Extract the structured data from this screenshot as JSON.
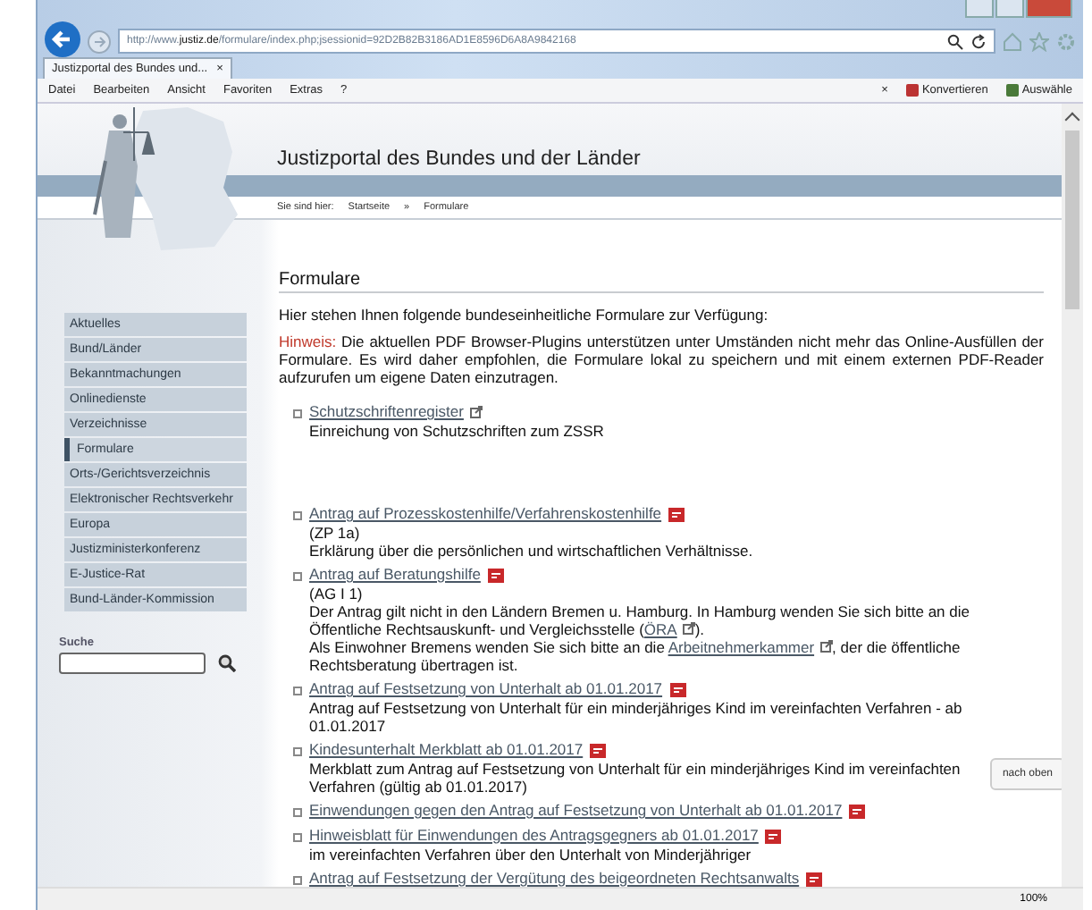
{
  "browser": {
    "address_host": "http://www.",
    "address_domain": "justiz.de",
    "address_path": "/formulare/index.php;jsessionid=92D2B82B3186AD1E8596D6A8A9842168",
    "tab_title": "Justizportal des Bundes und...",
    "tab_close": "×",
    "menu": [
      "Datei",
      "Bearbeiten",
      "Ansicht",
      "Favoriten",
      "Extras",
      "?"
    ],
    "toolbar_close": "×",
    "toolbar_buttons": [
      "Konvertieren",
      "Auswähle"
    ]
  },
  "page": {
    "site_title": "Justizportal des Bundes und der Länder",
    "breadcrumb": {
      "prefix": "Sie sind hier:",
      "items": [
        "Startseite",
        "Formulare"
      ],
      "separator": "»"
    },
    "sidebar": [
      {
        "label": "Aktuelles",
        "selected": false
      },
      {
        "label": "Bund/Länder",
        "selected": false
      },
      {
        "label": "Bekanntmachungen",
        "selected": false
      },
      {
        "label": "Onlinedienste",
        "selected": false
      },
      {
        "label": "Verzeichnisse",
        "selected": false
      },
      {
        "label": "Formulare",
        "selected": true
      },
      {
        "label": "Orts-/Gerichtsverzeichnis",
        "selected": false
      },
      {
        "label": "Elektronischer Rechtsverkehr",
        "selected": false
      },
      {
        "label": "Europa",
        "selected": false
      },
      {
        "label": "Justizministerkonferenz",
        "selected": false
      },
      {
        "label": "E-Justice-Rat",
        "selected": false
      },
      {
        "label": "Bund-Länder-Kommission",
        "selected": false
      }
    ],
    "search": {
      "label": "Suche"
    },
    "heading": "Formulare",
    "intro": "Hier stehen Ihnen folgende bundeseinheitliche Formulare zur Verfügung:",
    "notice": {
      "label": "Hinweis:",
      "text": "Die aktuellen PDF Browser-Plugins unterstützen unter Umständen nicht mehr das Online-Ausfüllen der Formulare. Es wird daher empfohlen, die Formulare lokal zu speichern und mit einem externen PDF-Reader aufzurufen um eigene Daten einzutragen."
    },
    "forms": [
      {
        "title": "Schutzschriftenregister",
        "kind": "external",
        "lines": [
          [
            {
              "text": "Einreichung von Schutzschriften zum ZSSR"
            }
          ]
        ]
      },
      {
        "title": "Antrag auf Prozesskostenhilfe/Verfahrenskostenhilfe",
        "kind": "pdf",
        "lines": [
          [
            {
              "text": "(ZP 1a)"
            }
          ],
          [
            {
              "text": "Erklärung über die persönlichen und wirtschaftlichen Verhältnisse."
            }
          ]
        ]
      },
      {
        "title": "Antrag auf Beratungshilfe",
        "kind": "pdf",
        "lines": [
          [
            {
              "text": "(AG I 1)"
            }
          ],
          [
            {
              "text": "Der Antrag gilt nicht in den Ländern Bremen u. Hamburg. In Hamburg wenden Sie sich bitte an die Öffentliche Rechtsauskunft- und Vergleichsstelle ("
            },
            {
              "link": "ÖRA"
            },
            {
              "text": ")."
            }
          ],
          [
            {
              "text": "Als Einwohner Bremens wenden Sie sich bitte an die "
            },
            {
              "link": "Arbeitnehmerkammer"
            },
            {
              "text": ", der die öffentliche Rechtsberatung übertragen ist."
            }
          ]
        ]
      },
      {
        "title": "Antrag auf Festsetzung von Unterhalt ab 01.01.2017",
        "kind": "pdf",
        "lines": [
          [
            {
              "text": "Antrag auf Festsetzung von Unterhalt für ein minderjähriges Kind im vereinfachten Verfahren - ab 01.01.2017"
            }
          ]
        ]
      },
      {
        "title": "Kindesunterhalt Merkblatt ab 01.01.2017",
        "kind": "pdf",
        "lines": [
          [
            {
              "text": "Merkblatt zum Antrag auf Festsetzung von Unterhalt für ein minderjähriges Kind im vereinfachten Verfahren (gültig ab 01.01.2017)"
            }
          ]
        ]
      },
      {
        "title": "Einwendungen gegen den Antrag auf Festsetzung von Unterhalt ab 01.01.2017",
        "kind": "pdf"
      },
      {
        "title": "Hinweisblatt für Einwendungen des Antragsgegners ab 01.01.2017",
        "kind": "pdf",
        "lines": [
          [
            {
              "text": "im vereinfachten Verfahren über den Unterhalt von Minderjähriger"
            }
          ]
        ]
      },
      {
        "title": "Antrag auf Festsetzung der Vergütung des beigeordneten Rechtsanwalts",
        "kind": "pdf"
      }
    ],
    "back_to_top": "nach oben"
  },
  "status_bar": {
    "zoom": "100%"
  }
}
